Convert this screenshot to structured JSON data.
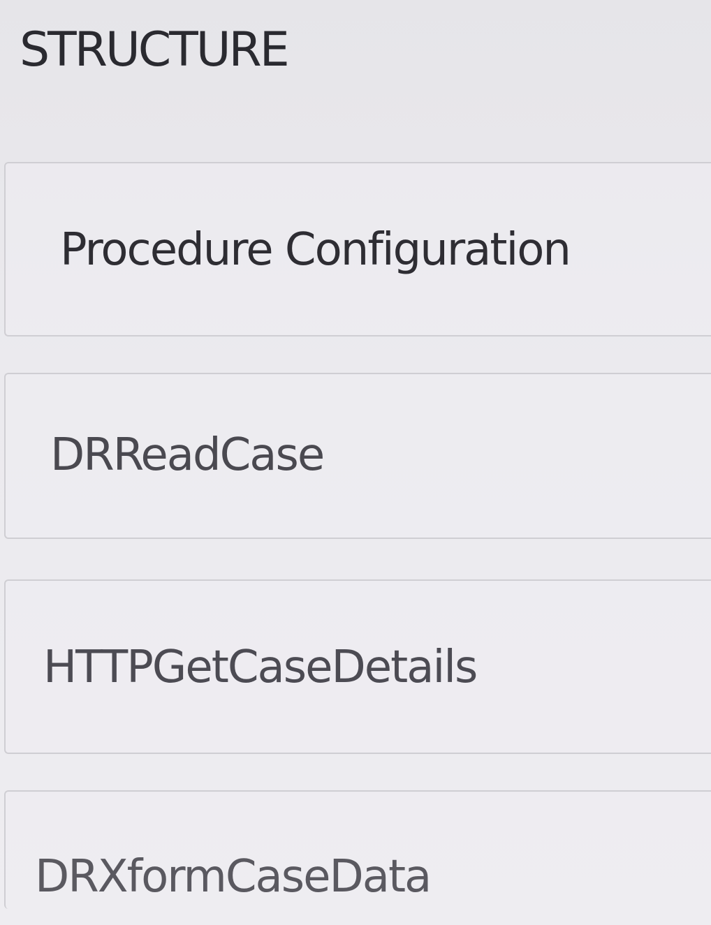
{
  "structure": {
    "title": "STRUCTURE",
    "items": [
      {
        "label": "Procedure Configuration"
      },
      {
        "label": "DRReadCase"
      },
      {
        "label": "HTTPGetCaseDetails"
      },
      {
        "label": "DRXformCaseData"
      }
    ]
  }
}
